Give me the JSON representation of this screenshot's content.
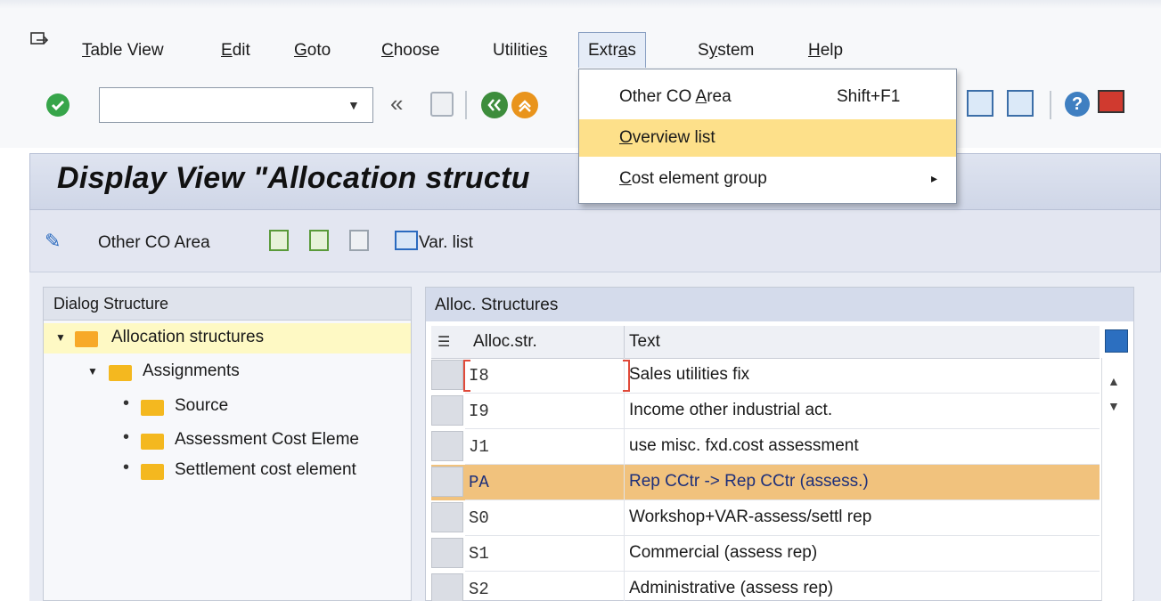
{
  "menubar": {
    "items": [
      {
        "label": "Table View",
        "mnemonic": "T"
      },
      {
        "label": "Edit",
        "mnemonic": "E"
      },
      {
        "label": "Goto",
        "mnemonic": "G"
      },
      {
        "label": "Choose",
        "mnemonic": "C"
      },
      {
        "label": "Utilities",
        "mnemonic": "s"
      },
      {
        "label": "Extras",
        "mnemonic": "a"
      },
      {
        "label": "System",
        "mnemonic": "y"
      },
      {
        "label": "Help",
        "mnemonic": "H"
      }
    ]
  },
  "menubar_text": {
    "table_view_rest": "able View",
    "table_view_key": "T",
    "edit_rest": "dit",
    "edit_key": "E",
    "goto_rest": "oto",
    "goto_key": "G",
    "choose_rest": "hoose",
    "choose_key": "C",
    "utilities_head": "Utilitie",
    "utilities_key": "s",
    "extras_head": "Extr",
    "extras_key": "a",
    "extras_tail": "s",
    "system_head": "S",
    "system_key": "y",
    "system_tail": "stem",
    "help_key": "H",
    "help_rest": "elp"
  },
  "toolbar": {
    "command_value": "",
    "prev_glyph": "«"
  },
  "title": "Display View \"Allocation structu",
  "app_toolbar": {
    "other_co_area": "Other CO Area",
    "var_list": "Var. list"
  },
  "dialog_structure": {
    "title": "Dialog Structure",
    "tree": {
      "root": "Allocation structures",
      "child": "Assignments",
      "leaves": [
        "Source",
        "Assessment Cost Eleme",
        "Settlement cost element"
      ]
    }
  },
  "table": {
    "title": "Alloc. Structures",
    "columns": [
      "Alloc.str.",
      "Text"
    ],
    "rows": [
      {
        "code": "I8",
        "text": "Sales utilities fix"
      },
      {
        "code": "I9",
        "text": "Income other industrial act."
      },
      {
        "code": "J1",
        "text": "use misc. fxd.cost assessment"
      },
      {
        "code": "PA",
        "text": "Rep CCtr -> Rep CCtr (assess.)"
      },
      {
        "code": "S0",
        "text": "Workshop+VAR-assess/settl rep"
      },
      {
        "code": "S1",
        "text": "Commercial (assess rep)"
      },
      {
        "code": "S2",
        "text": "Administrative (assess rep)"
      }
    ],
    "highlighted_row": "PA"
  },
  "extras_menu": {
    "items": [
      {
        "label_head": "Other CO ",
        "label_key": "A",
        "label_tail": "rea",
        "shortcut": "Shift+F1"
      },
      {
        "label_key": "O",
        "label_tail": "verview list"
      },
      {
        "label_key": "C",
        "label_tail": "ost element group",
        "arrow": "▸"
      }
    ]
  },
  "colors": {
    "highlight_row": "#f1c27d",
    "menu_hover": "#fde08a",
    "tree_selected": "#fef9c4",
    "folder": "#f4b81f"
  }
}
